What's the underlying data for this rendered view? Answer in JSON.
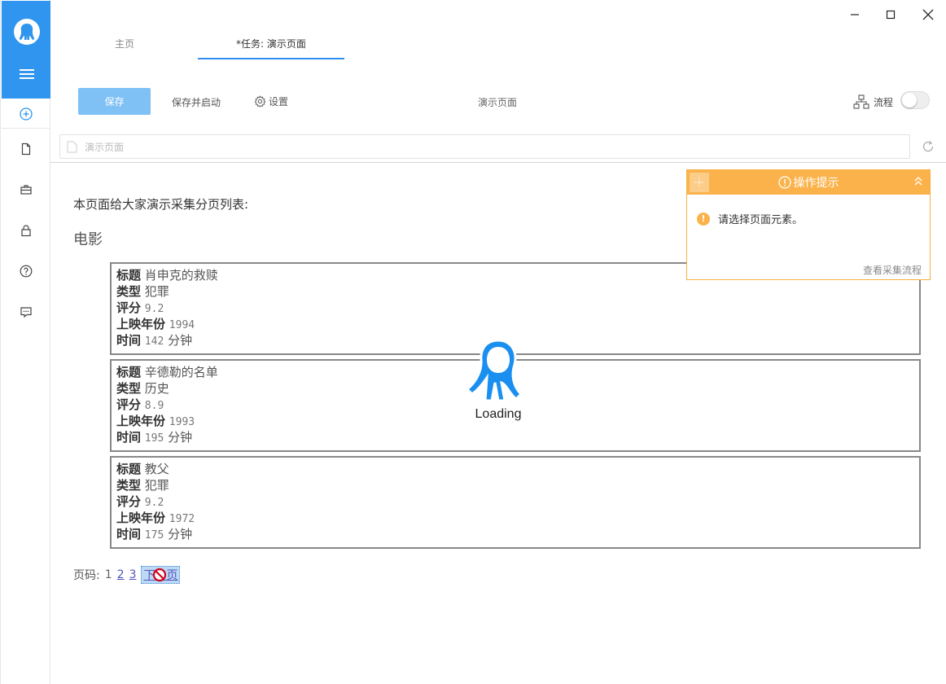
{
  "tabs": [
    {
      "label": "主页"
    },
    {
      "label": "*任务: 演示页面"
    }
  ],
  "toolbar": {
    "save_label": "保存",
    "save_and_start_label": "保存并启动",
    "settings_label": "设置",
    "page_name": "演示页面",
    "flow_label": "流程",
    "flow_enabled": false
  },
  "urlbar": {
    "placeholder": "演示页面"
  },
  "page": {
    "intro": "本页面给大家演示采集分页列表:",
    "section_title": "电影",
    "labels": {
      "title": "标题",
      "genre": "类型",
      "rating": "评分",
      "year": "上映年份",
      "duration": "时间",
      "minutes": "分钟"
    },
    "movies": [
      {
        "title": "肖申克的救赎",
        "genre": "犯罪",
        "rating": "9.2",
        "year": "1994",
        "duration": "142"
      },
      {
        "title": "辛德勒的名单",
        "genre": "历史",
        "rating": "8.9",
        "year": "1993",
        "duration": "195"
      },
      {
        "title": "教父",
        "genre": "犯罪",
        "rating": "9.2",
        "year": "1972",
        "duration": "175"
      }
    ],
    "pager": {
      "label": "页码:",
      "pages": [
        "1",
        "2",
        "3"
      ],
      "next_label": "下一页"
    }
  },
  "loading": {
    "text": "Loading"
  },
  "hint_panel": {
    "title": "操作提示",
    "message": "请选择页面元素。",
    "link": "查看采集流程",
    "accent_color": "#fbb24b"
  },
  "colors": {
    "primary": "#2f95ee",
    "save_button": "#7fc0f5"
  }
}
